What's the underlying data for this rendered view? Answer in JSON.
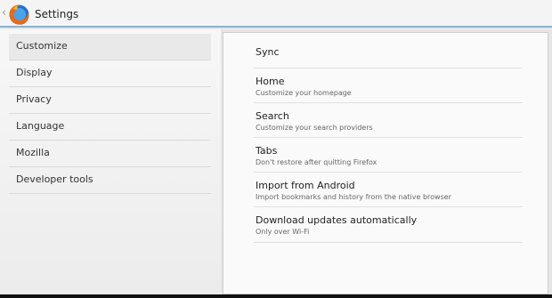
{
  "actionbar": {
    "title": "Settings",
    "back_glyph": "‹",
    "logo_icon": "firefox-logo"
  },
  "sidebar": {
    "items": [
      {
        "label": "Customize"
      },
      {
        "label": "Display"
      },
      {
        "label": "Privacy"
      },
      {
        "label": "Language"
      },
      {
        "label": "Mozilla"
      },
      {
        "label": "Developer tools"
      }
    ]
  },
  "prefs": {
    "items": [
      {
        "title": "Sync",
        "summary": ""
      },
      {
        "title": "Home",
        "summary": "Customize your homepage"
      },
      {
        "title": "Search",
        "summary": "Customize your search providers"
      },
      {
        "title": "Tabs",
        "summary": "Don't restore after quitting Firefox"
      },
      {
        "title": "Import from Android",
        "summary": "Import bookmarks and history from the native browser"
      },
      {
        "title": "Download updates automatically",
        "summary": "Only over Wi-Fi"
      }
    ]
  },
  "colors": {
    "accent": "#7fb6d6",
    "selected_item_bg": "#e9e9e9"
  }
}
